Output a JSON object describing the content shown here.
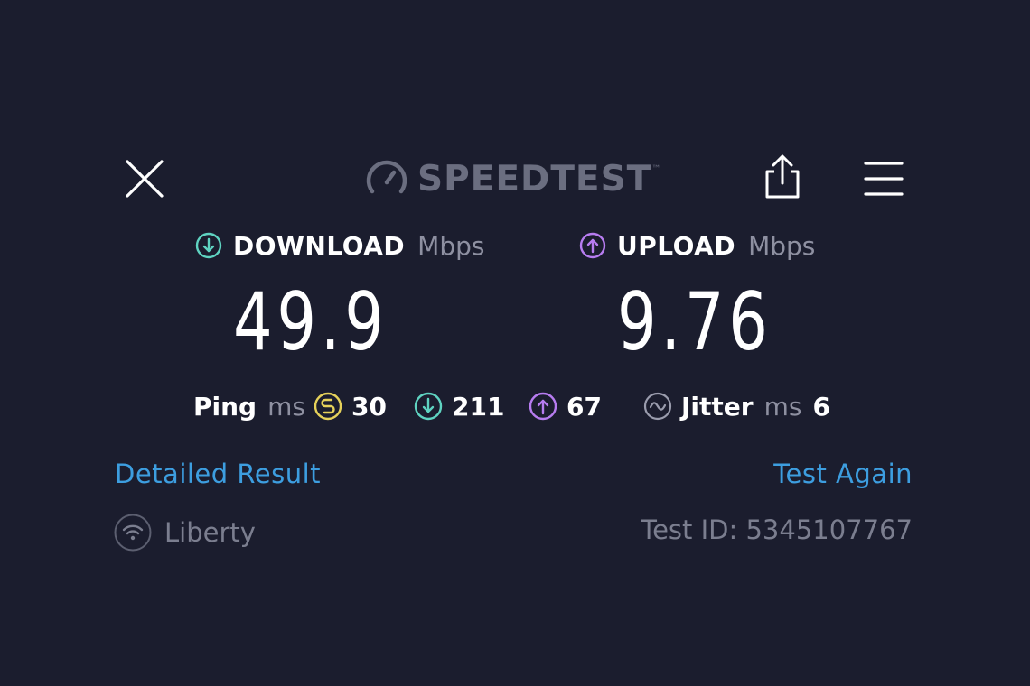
{
  "header": {
    "logo_text": "SPEEDTEST",
    "logo_mark": "™",
    "close_icon": "close-icon",
    "share_icon": "share-icon",
    "menu_icon": "hamburger-menu-icon"
  },
  "download": {
    "label": "DOWNLOAD",
    "unit": "Mbps",
    "value": "49.9",
    "icon": "arrow-down-circle-icon",
    "color": "#5fd3c1"
  },
  "upload": {
    "label": "UPLOAD",
    "unit": "Mbps",
    "value": "9.76",
    "icon": "arrow-up-circle-icon",
    "color": "#b77cf0"
  },
  "stats": {
    "ping_label": "Ping",
    "ping_unit": "ms",
    "idle_value": "30",
    "idle_icon": "idle-latency-icon",
    "idle_color": "#e6d15a",
    "download_latency": "211",
    "upload_latency": "67",
    "jitter_label": "Jitter",
    "jitter_unit": "ms",
    "jitter_value": "6",
    "jitter_icon": "jitter-wave-icon"
  },
  "links": {
    "detailed": "Detailed Result",
    "again": "Test Again",
    "color": "#3d9ee0"
  },
  "footer": {
    "provider": "Liberty",
    "provider_icon": "wifi-icon",
    "test_id": "Test ID: 5345107767"
  }
}
